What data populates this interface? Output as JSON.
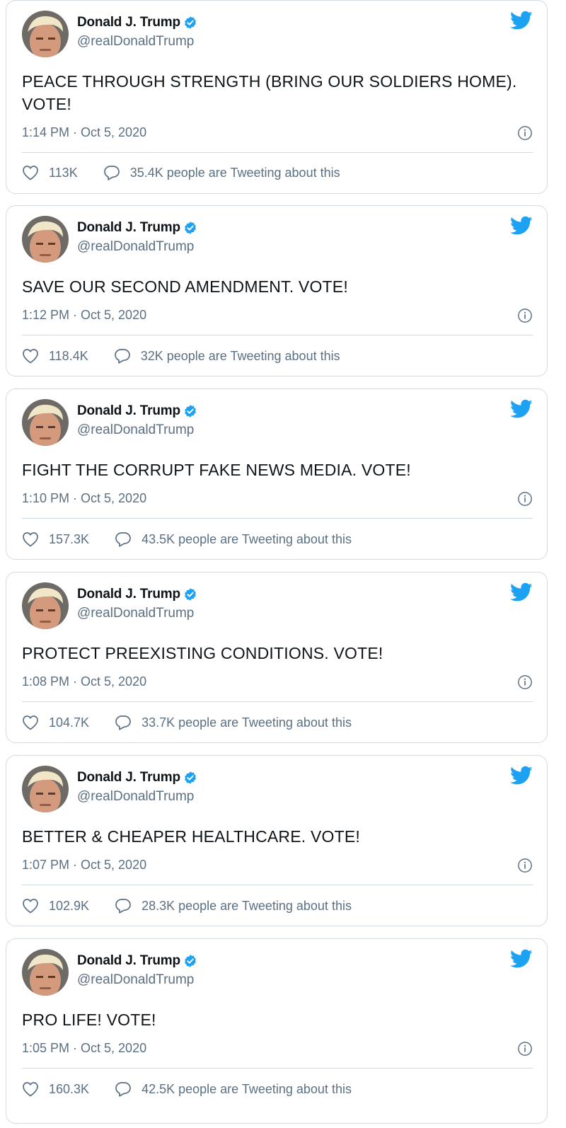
{
  "tweets": [
    {
      "name": "Donald J. Trump",
      "handle": "@realDonaldTrump",
      "text": "PEACE THROUGH STRENGTH (BRING OUR SOLDIERS HOME). VOTE!",
      "timestamp": "1:14 PM · Oct 5, 2020",
      "likes": "113K",
      "tweeting": "35.4K people are Tweeting about this"
    },
    {
      "name": "Donald J. Trump",
      "handle": "@realDonaldTrump",
      "text": "SAVE OUR SECOND AMENDMENT. VOTE!",
      "timestamp": "1:12 PM · Oct 5, 2020",
      "likes": "118.4K",
      "tweeting": "32K people are Tweeting about this"
    },
    {
      "name": "Donald J. Trump",
      "handle": "@realDonaldTrump",
      "text": "FIGHT THE CORRUPT FAKE NEWS MEDIA. VOTE!",
      "timestamp": "1:10 PM · Oct 5, 2020",
      "likes": "157.3K",
      "tweeting": "43.5K people are Tweeting about this"
    },
    {
      "name": "Donald J. Trump",
      "handle": "@realDonaldTrump",
      "text": "PROTECT PREEXISTING CONDITIONS. VOTE!",
      "timestamp": "1:08 PM · Oct 5, 2020",
      "likes": "104.7K",
      "tweeting": "33.7K people are Tweeting about this"
    },
    {
      "name": "Donald J. Trump",
      "handle": "@realDonaldTrump",
      "text": "BETTER & CHEAPER HEALTHCARE. VOTE!",
      "timestamp": "1:07 PM · Oct 5, 2020",
      "likes": "102.9K",
      "tweeting": "28.3K people are Tweeting about this"
    },
    {
      "name": "Donald J. Trump",
      "handle": "@realDonaldTrump",
      "text": "PRO LIFE! VOTE!",
      "timestamp": "1:05 PM · Oct 5, 2020",
      "likes": "160.3K",
      "tweeting": "42.5K people are Tweeting about this"
    }
  ],
  "icons": {
    "brand": "twitter-bird-icon",
    "verified": "verified-badge-icon",
    "info": "info-icon",
    "like": "heart-icon",
    "reply": "speech-bubble-icon"
  },
  "colors": {
    "brand_blue": "#1da1f2",
    "secondary_text": "#5b7083",
    "border": "#d3dbe1"
  }
}
